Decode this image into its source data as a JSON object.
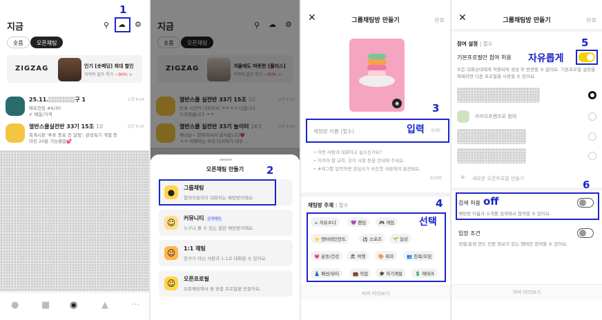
{
  "annotations": {
    "n1": "1",
    "n2": "2",
    "n3": "3",
    "n4": "4",
    "n5": "5",
    "n6": "6",
    "input": "입력",
    "select": "선택",
    "free": "자유롭게",
    "off": "off"
  },
  "screen1": {
    "title": "지금",
    "tabs": [
      "숏폼",
      "오픈채팅"
    ],
    "ad": {
      "brand": "ZIGZAG",
      "headline": "인기 [숏패딩] 최대 할인",
      "sub": "직잭픽 블프 특가 ",
      "discount": "~90% >"
    },
    "chats": [
      {
        "name": "25.11.",
        "name_suffix": "구 1",
        "msg1": "배로천임 #6/30",
        "msg2": "✔ 배움/가격",
        "time": "오전 8:24"
      },
      {
        "name": "열반스쿨실전반 33기 15조",
        "count": "10",
        "msg1": "독계시판 '투표 종료 전 알림': 완성독기 개별 종",
        "msg2": "마킹 20분 가능월말💕",
        "time": "오전 9:15"
      }
    ]
  },
  "screen2": {
    "title": "지금",
    "tabs": [
      "숏폼",
      "오픈채팅"
    ],
    "ad": {
      "brand": "ZIGZAG",
      "headline": "겨울에도 따뜻한 [플리스]",
      "sub": "직잭픽 블프 특가 ",
      "discount": "~90% >"
    },
    "chats": [
      {
        "name": "열반스쿨 실전반 33기 15조",
        "count": "10",
        "msg1": "인워 시간이 다되어서 ㅋㅋㅋㅋ 다음니다",
        "msg2": "드리겠습니다 ㅋㅋ",
        "time": "오전 8:10"
      },
      {
        "name": "열반스쿨 실전반 33기 놀이터",
        "count": "263",
        "msg1": "캐나남~ 한목하서서 감사합니다💗",
        "msg2": "ㅋㅋ 이해이는 우리 다지하기 대부 ...",
        "time": "오전 8:05"
      }
    ],
    "sheet_title": "오픈채팅 만들기",
    "options": [
      {
        "title": "그룹채팅",
        "desc": "참여자들끼리 대화하는 채팅방이에요.",
        "badge": ""
      },
      {
        "title": "커뮤니티",
        "desc": "누구나 볼 수 있는 열린 채팅방이에요.",
        "badge": "공개채팅"
      },
      {
        "title": "1:1 채팅",
        "desc": "친구가 아닌 사람과 1:1로 대화할 수 있어요.",
        "badge": ""
      },
      {
        "title": "오픈프로필",
        "desc": "오픈채팅에서 쓸 맞춤 프로필을 만들어요.",
        "badge": ""
      }
    ]
  },
  "screen3": {
    "header": "그룹채팅방 만들기",
    "done": "완료",
    "name_placeholder": "채팅방 이름 (필수)",
    "name_count": "0/30",
    "desc_lines": [
      "• 어떤 사람과 대화하고 싶으신가요?",
      "• 지켜야 할 규칙, 공지 사항 등을 안내해 주세요.",
      "• #태그를 입력하면 관심사가 비슷한 사람에게 발견돼요."
    ],
    "desc_count": "0/200",
    "topic_label": "채팅방 주제",
    "topic_req": "| 필수",
    "topics": [
      [
        {
          "icon": "☕",
          "label": "자유수다"
        },
        {
          "icon": "💜",
          "label": "팬덤"
        },
        {
          "icon": "🎮",
          "label": "게임"
        }
      ],
      [
        {
          "icon": "⭐",
          "label": "엔터테인먼트"
        },
        {
          "icon": "⚽",
          "label": "스포츠"
        },
        {
          "icon": "🌱",
          "label": "일상"
        }
      ],
      [
        {
          "icon": "💗",
          "label": "운동/건강"
        },
        {
          "icon": "🏖",
          "label": "여행"
        },
        {
          "icon": "🎨",
          "label": "취미"
        },
        {
          "icon": "👥",
          "label": "친목/모임"
        }
      ],
      [
        {
          "icon": "👗",
          "label": "패션/뷰티"
        },
        {
          "icon": "💼",
          "label": "직업"
        },
        {
          "icon": "🎓",
          "label": "자기계발"
        },
        {
          "icon": "💲",
          "label": "재테크"
        }
      ]
    ],
    "preview": "커버 미리보기"
  },
  "screen4": {
    "header": "그룹채팅방 만들기",
    "done": "완료",
    "section_label": "참여 설정",
    "section_req": "| 필수",
    "default_profile": "기본프로필만 참여 허용",
    "default_desc": "모든 대화상대에게 적용되며 생성 후 변경할 수 없어요. 기본프로필 설정을 해제하면 다른 프로필을 사용할 수 있어요.",
    "profiles": [
      {
        "label": "",
        "selected": true
      },
      {
        "label": "카카오프렌즈로 참여",
        "selected": false
      },
      {
        "label": "",
        "selected": false
      },
      {
        "label": "",
        "selected": false
      }
    ],
    "new_profile": "새로운 오픈프로필 만들기",
    "search_label": "검색 허용",
    "search_desc": "채팅방 이름과 소개를 검색해서 참여할 수 있어요.",
    "entry_label": "입장 조건",
    "entry_desc": "성별/출생 연도 인증 정보가 있는 멤버만 참여할 수 있어요.",
    "preview": "커버 미리보기"
  }
}
